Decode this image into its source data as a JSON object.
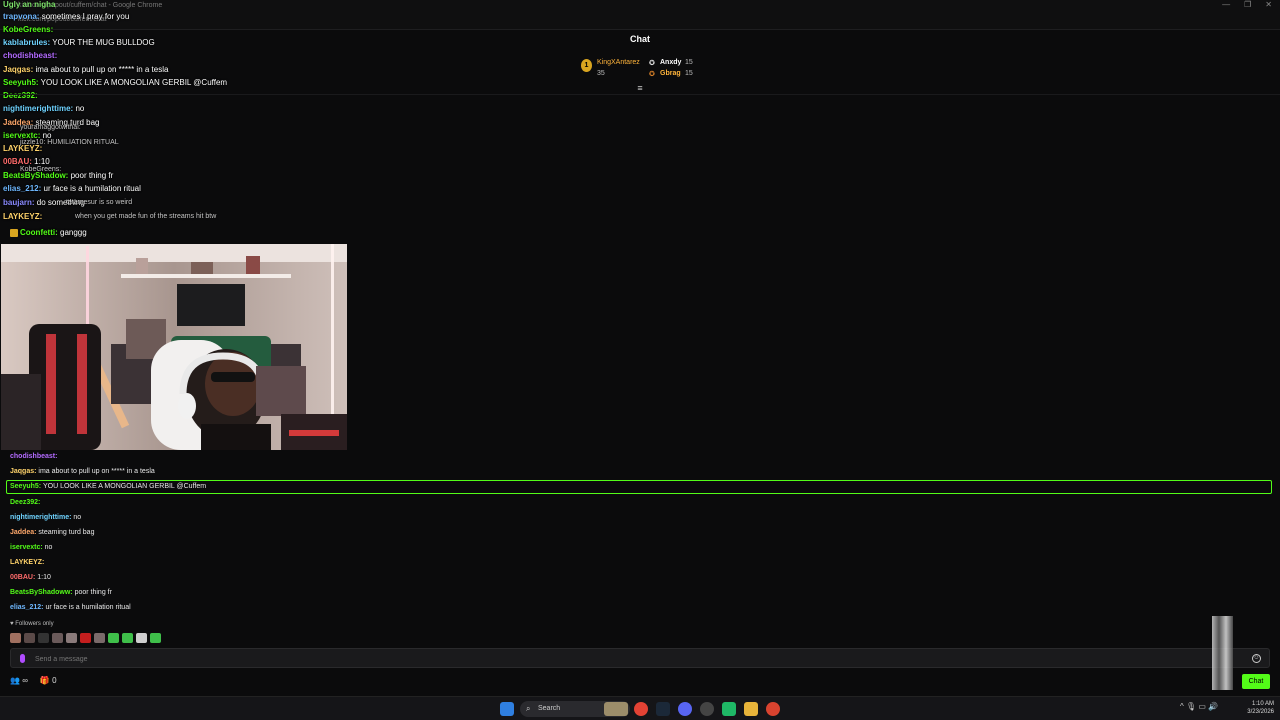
{
  "browser": {
    "title": "kick.com/popout/cuffem/chat - Google Chrome",
    "url": "kick.com/popout/cuffem/chat"
  },
  "header": {
    "title": "Chat"
  },
  "leaderboard": {
    "first": {
      "rank": "1",
      "name": "KingXAntarez",
      "points": "35"
    },
    "second": {
      "name": "Anxdy",
      "points": "15"
    },
    "third": {
      "name": "Gbrag",
      "points": "15"
    }
  },
  "overlay": {
    "lines": [
      {
        "user": "Ugly an nigha",
        "text": "",
        "color": "#7ee36b"
      },
      {
        "user": "trapvona:",
        "text": "sometimes I pray for you",
        "color": "#6fb8ff"
      },
      {
        "user": "KobeGreens:",
        "text": "",
        "color": "#53fc18"
      },
      {
        "user": "kablabrules:",
        "text": "YOUR THE MUG BULLDOG",
        "color": "#6fd3ff"
      },
      {
        "user": "chodishbeast:",
        "text": "",
        "color": "#b36bff"
      },
      {
        "user": "Jaqgas:",
        "text": "ima about to pull up on ***** in a tesla",
        "color": "#ffd36b"
      },
      {
        "user": "Seeyuh5:",
        "text": "YOU LOOK LIKE A MONGOLIAN GERBIL @Cuffem",
        "color": "#53fc18"
      },
      {
        "user": "Deez392:",
        "text": "",
        "color": "#53fc18"
      },
      {
        "user": "nightimerighttime:",
        "text": "no",
        "color": "#6fd3ff"
      },
      {
        "user": "Jaddea:",
        "text": "steaming turd bag",
        "color": "#ffa86b"
      },
      {
        "user": "iservextc:",
        "text": "no",
        "color": "#53fc18"
      },
      {
        "user": "LAYKEYZ:",
        "text": "",
        "color": "#ffd36b"
      },
      {
        "user": "00BAU:",
        "text": "1:10",
        "color": "#ff6b6b"
      },
      {
        "user": "BeatsByShadow:",
        "text": "poor thing fr",
        "color": "#53fc18"
      },
      {
        "user": "elias_212:",
        "text": "ur face is a humilation ritual",
        "color": "#6fb8ff"
      },
      {
        "user": "baujarn:",
        "text": "do something",
        "color": "#8a8aff"
      },
      {
        "user": "LAYKEYZ:",
        "text": "",
        "color": "#ffd36b"
      }
    ],
    "ghosts": [
      {
        "text": "youramaggotwithai:"
      },
      {
        "text": "jizzle10: HUMILIATION RITUAL"
      },
      {
        "text": "KobeGreens:"
      },
      {
        "text": "tatamesur is so weird"
      },
      {
        "text": "when you get made fun of the streams hit btw"
      }
    ],
    "confetti": {
      "user": "Coonfetti:",
      "text": "ganggg"
    }
  },
  "chat": {
    "messages": [
      {
        "user": "chodishbeast:",
        "text": "",
        "color": "#b36bff"
      },
      {
        "user": "Jaqgas:",
        "text": "ima about to pull up on ***** in a tesla",
        "color": "#ffd36b"
      },
      {
        "user": "Seeyuh5:",
        "text": "YOU LOOK LIKE A MONGOLIAN GERBIL @Cuffem",
        "color": "#53fc18"
      },
      {
        "user": "Deez392:",
        "text": "",
        "color": "#53fc18"
      },
      {
        "user": "nightimerighttime:",
        "text": "no",
        "color": "#6fd3ff"
      },
      {
        "user": "Jaddea:",
        "text": "steaming turd bag",
        "color": "#ffa86b"
      },
      {
        "user": "iservextc:",
        "text": "no",
        "color": "#53fc18"
      },
      {
        "user": "LAYKEYZ:",
        "text": "",
        "color": "#ffd36b"
      },
      {
        "user": "00BAU:",
        "text": "1:10",
        "color": "#ff6b6b"
      },
      {
        "user": "BeatsByShadoww:",
        "text": "poor thing fr",
        "color": "#53fc18"
      },
      {
        "user": "elias_212:",
        "text": "ur face is a humilation ritual",
        "color": "#6fb8ff"
      }
    ],
    "followers_only": "Followers only",
    "input_placeholder": "Send a message",
    "send_label": "Chat",
    "viewers_label": "∞",
    "gift_count": "0",
    "accent": "#53fc18"
  },
  "taskbar": {
    "search_label": "Search",
    "time": "1:10 AM",
    "date": "3/23/2026"
  }
}
